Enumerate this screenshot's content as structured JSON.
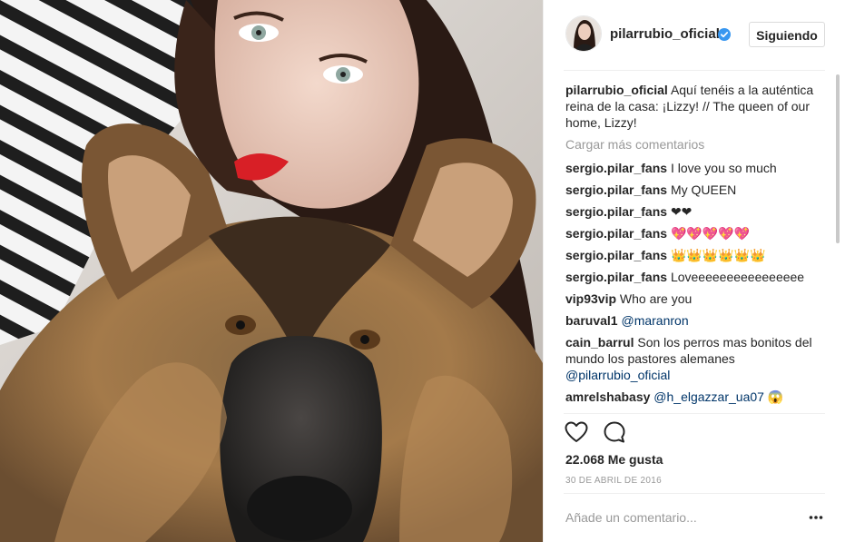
{
  "post": {
    "username": "pilarrubio_oficial",
    "follow_label": "Siguiendo",
    "likes_text": "22.068 Me gusta",
    "date_text": "30 DE ABRIL DE 2016",
    "comment_placeholder": "Añade un comentario...",
    "load_more_label": "Cargar más comentarios",
    "caption": {
      "user": "pilarrubio_oficial",
      "text": "Aquí tenéis a la auténtica reina de la casa: ¡Lizzy! // The queen of our home, Lizzy!"
    },
    "comments": [
      {
        "user": "sergio.pilar_fans",
        "text": "I love you so much"
      },
      {
        "user": "sergio.pilar_fans",
        "text": "My QUEEN"
      },
      {
        "user": "sergio.pilar_fans",
        "text": "❤❤"
      },
      {
        "user": "sergio.pilar_fans",
        "text": "💖💖💖💖💖"
      },
      {
        "user": "sergio.pilar_fans",
        "text": "👑👑👑👑👑👑"
      },
      {
        "user": "sergio.pilar_fans",
        "text": "Loveeeeeeeeeeeeeeee"
      },
      {
        "user": "vip93vip",
        "text": "Who are you"
      },
      {
        "user": "baruval1",
        "text": "@maranron"
      },
      {
        "user": "cain_barrul",
        "text": "Son los perros mas bonitos del mundo los pastores alemanes",
        "mention": "@pilarrubio_oficial"
      },
      {
        "user": "amrelshabasy",
        "text": "@h_elgazzar_ua07 😱"
      }
    ],
    "icons": {
      "like": "heart-icon",
      "comment": "comment-bubble-icon",
      "verified": "verified-badge-icon",
      "more": "more-options-icon"
    },
    "colors": {
      "verified": "#3897f0",
      "mention": "#003569",
      "muted": "#999999"
    }
  }
}
